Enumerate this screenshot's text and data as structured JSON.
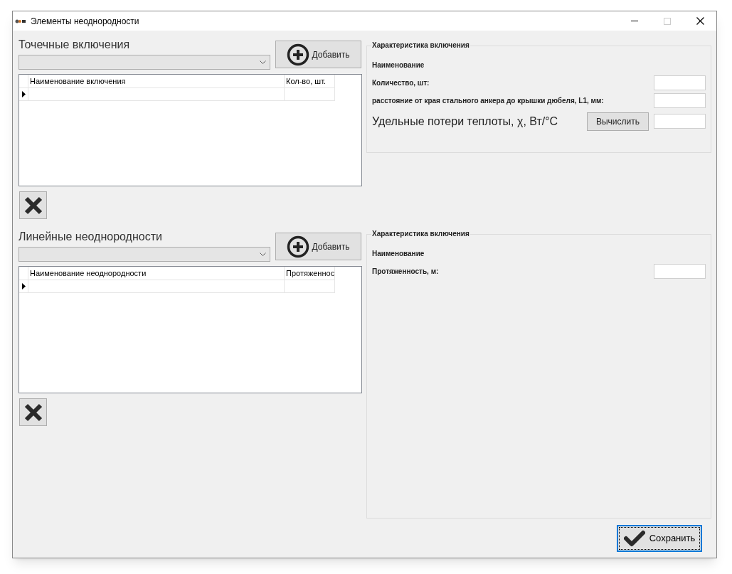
{
  "window": {
    "title": "Элементы неоднородности"
  },
  "sections": [
    {
      "title": "Точечные включения",
      "add_button": "Добавить",
      "table": {
        "columns": [
          "Наименование включения",
          "Кол-во, шт."
        ],
        "rows": [
          {
            "current": true
          }
        ]
      }
    },
    {
      "title": "Линейные неоднородности",
      "add_button": "Добавить",
      "table": {
        "columns": [
          "Наименование неоднородности",
          "Протяженнос"
        ],
        "rows": [
          {
            "current": true
          }
        ]
      }
    }
  ],
  "details": [
    {
      "legend": "Характеристика включения",
      "fields": [
        {
          "kind": "heading",
          "label": "Наименование"
        },
        {
          "kind": "input",
          "label": "Количество, шт:"
        },
        {
          "kind": "input",
          "label": "расстояние от края стального анкера до крышки дюбеля, L1, мм:"
        },
        {
          "kind": "compute",
          "label": "Удельные потери теплоты, χ, Вт/°C",
          "button": "Вычислить"
        }
      ]
    },
    {
      "legend": "Характеристика включения",
      "fields": [
        {
          "kind": "heading",
          "label": "Наименование"
        },
        {
          "kind": "input",
          "label": "Протяженность, м:"
        }
      ]
    }
  ],
  "save_button": "Сохранить"
}
